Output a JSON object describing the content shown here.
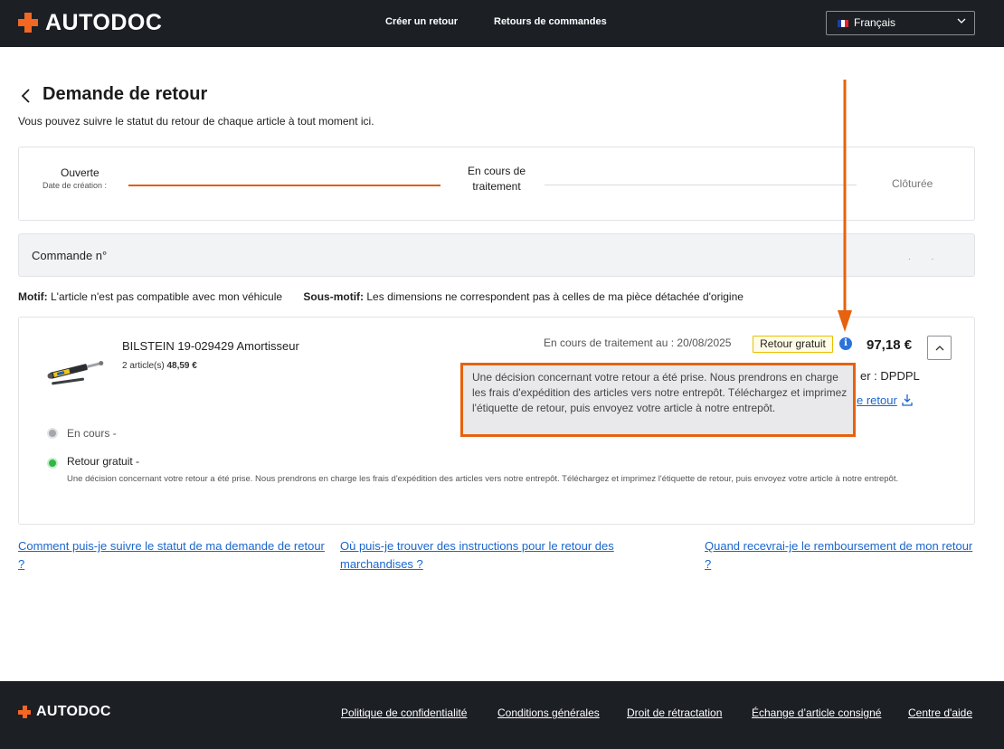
{
  "header": {
    "brand": "AUTODOC",
    "nav": {
      "create_return": "Créer un retour",
      "order_returns": "Retours de commandes"
    },
    "language": {
      "selected": "Français",
      "flag_colors": [
        "#1f3fa0",
        "#ffffff",
        "#e1262b"
      ]
    }
  },
  "page": {
    "title": "Demande de retour",
    "subtitle": "Vous pouvez suivre le statut du retour de chaque article à tout moment ici."
  },
  "progress": {
    "steps": [
      {
        "label": "Ouverte",
        "sublabel": "Date de création :"
      },
      {
        "label": "En cours de traitement"
      },
      {
        "label": "Clôturée"
      }
    ],
    "accent_color": "#e35d15"
  },
  "order": {
    "label": "Commande n°",
    "masked": ". ."
  },
  "reasons": {
    "motif_label": "Motif:",
    "motif_value": " L'article n'est pas compatible avec mon véhicule",
    "sub_motif_label": "Sous-motif:",
    "sub_motif_value": " Les dimensions ne correspondent pas à celles de ma pièce détachée d'origine"
  },
  "item": {
    "name": "BILSTEIN 19-029429 Amortisseur",
    "qty_text": "2 article(s)",
    "unit_price": "48,59 €",
    "status_text": "En cours de traitement au : 20/08/2025",
    "badge": "Retour gratuit",
    "info_glyph": "i",
    "total_price": "97,18 €",
    "carrier": "er : DPDPL",
    "return_label_link": "e retour",
    "tooltip": "Une décision concernant votre retour a été prise. Nous prendrons en charge les frais d'expédition des articles vers notre entrepôt. Téléchargez et imprimez l'étiquette de retour, puis envoyez votre article à notre entrepôt.",
    "timeline": [
      {
        "label": "En cours -",
        "state": "grey"
      },
      {
        "label": "Retour gratuit -",
        "state": "green",
        "description": "Une décision concernant votre retour a été prise. Nous prendrons en charge les frais d'expédition des articles vers notre entrepôt. Téléchargez et imprimez l'étiquette de retour, puis envoyez votre article à notre entrepôt."
      }
    ]
  },
  "help_links": [
    "Comment puis-je suivre le statut de ma demande de retour ?",
    "Où puis-je trouver des instructions pour le retour des marchandises ?",
    "Quand recevrai-je le remboursement de mon retour ?"
  ],
  "footer": {
    "brand": "AUTODOC",
    "links": [
      "Politique de confidentialité",
      "Conditions générales",
      "Droit de rétractation",
      "Échange d’article consigné",
      "Centre d'aide"
    ]
  },
  "icons": {
    "back": "chevron-left-icon",
    "lang": "chevron-down-icon",
    "collapse": "chevron-up-icon",
    "download": "download-icon",
    "info": "info-icon"
  },
  "colors": {
    "header_bg": "#1c1f24",
    "brand_orange": "#f26722",
    "link_blue": "#1a66cc",
    "success_green": "#2fb843"
  }
}
